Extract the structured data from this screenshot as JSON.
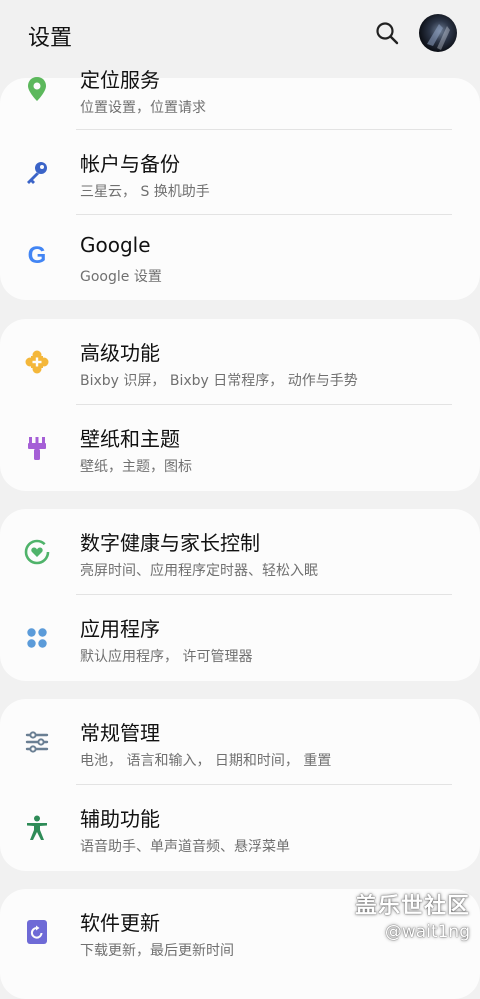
{
  "header": {
    "title": "设置",
    "search_icon": "search-icon",
    "avatar": "avatar"
  },
  "groups": [
    {
      "items": [
        {
          "id": "location",
          "label": "定位服务",
          "sub": "位置设置，位置请求",
          "icon": "location-pin-icon",
          "color": "#5cb85c"
        },
        {
          "id": "accounts",
          "label": "帐户与备份",
          "sub": "三星云， S 换机助手",
          "icon": "key-icon",
          "color": "#3b64c8"
        },
        {
          "id": "google",
          "label": "Google",
          "sub": "Google 设置",
          "icon": "google-icon",
          "color": "#4285f4"
        }
      ]
    },
    {
      "items": [
        {
          "id": "advanced",
          "label": "高级功能",
          "sub": "Bixby 识屏， Bixby 日常程序， 动作与手势",
          "icon": "puzzle-icon",
          "color": "#f4b73a"
        },
        {
          "id": "wallpaper",
          "label": "壁纸和主题",
          "sub": "壁纸，主题，图标",
          "icon": "paintbrush-icon",
          "color": "#a55fd6"
        }
      ]
    },
    {
      "items": [
        {
          "id": "wellbeing",
          "label": "数字健康与家长控制",
          "sub": "亮屏时间、应用程序定时器、轻松入眠",
          "icon": "wellbeing-heart-icon",
          "color": "#4fb36a"
        },
        {
          "id": "apps",
          "label": "应用程序",
          "sub": "默认应用程序， 许可管理器",
          "icon": "apps-grid-icon",
          "color": "#5b9bd9"
        }
      ]
    },
    {
      "items": [
        {
          "id": "general",
          "label": "常规管理",
          "sub": "电池， 语言和输入， 日期和时间， 重置",
          "icon": "sliders-icon",
          "color": "#6a7f93"
        },
        {
          "id": "accessibility",
          "label": "辅助功能",
          "sub": "语音助手、单声道音频、悬浮菜单",
          "icon": "accessibility-icon",
          "color": "#2e8b57"
        }
      ]
    },
    {
      "items": [
        {
          "id": "update",
          "label": "软件更新",
          "sub": "下载更新，最后更新时间",
          "icon": "software-update-icon",
          "color": "#6e6ad6"
        }
      ]
    }
  ],
  "watermark": {
    "line1": "盖乐世社区",
    "line2": "@wait1ng"
  }
}
